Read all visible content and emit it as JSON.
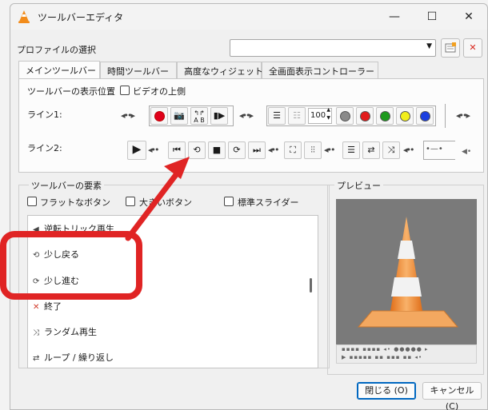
{
  "window": {
    "title": "ツールバーエディタ",
    "controls": {
      "minimize": "—",
      "maximize": "☐",
      "close": "✕"
    }
  },
  "profile": {
    "label": "プロファイルの選択",
    "selected": "",
    "new_icon": "new-profile-icon",
    "delete_icon": "delete-profile-icon"
  },
  "tabs": [
    "メインツールバー",
    "時間ツールバー",
    "高度なウィジェット",
    "全画面表示コントローラー"
  ],
  "toolbar_panel": {
    "position_label": "ツールバーの表示位置",
    "above_video_label": "ビデオの上側",
    "line1_label": "ライン1:",
    "line2_label": "ライン2:",
    "volume_value": "100"
  },
  "elements": {
    "title": "ツールバーの要素",
    "flat_buttons": "フラットなボタン",
    "big_buttons": "大きいボタン",
    "native_slider": "標準スライダー",
    "items": [
      {
        "label": "逆転トリック再生",
        "icon": "◀"
      },
      {
        "label": "少し戻る",
        "icon": "⟲"
      },
      {
        "label": "少し進む",
        "icon": "⟳"
      },
      {
        "label": "終了",
        "icon": "✕"
      },
      {
        "label": "ランダム再生",
        "icon": "⤨"
      },
      {
        "label": "ループ / 繰り返し",
        "icon": "⇄"
      }
    ]
  },
  "preview": {
    "title": "プレビュー"
  },
  "buttons": {
    "close": "閉じる (O)",
    "cancel": "キャンセル (C)"
  },
  "colors": {
    "annotation_red": "#e02424",
    "record_red": "#e0001b",
    "dot_gray": "#8a8a8a",
    "dot_red": "#e21b1b",
    "dot_green": "#1e9a1e",
    "dot_yellow": "#f2ee1c",
    "dot_blue": "#1c3fe0",
    "accent_blue": "#0067c0"
  }
}
